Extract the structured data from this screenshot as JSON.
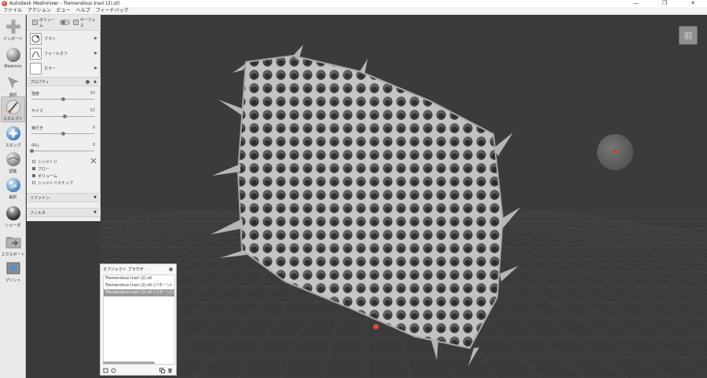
{
  "window": {
    "title": "Autodesk Meshmixer - Tremendous Inari (2).stl",
    "controls": [
      "—",
      "❐",
      "✕"
    ]
  },
  "menu": [
    "ファイル",
    "アクション",
    "ビュー",
    "ヘルプ",
    "フィードバック"
  ],
  "toolbar": [
    {
      "label": "インポート",
      "icon": "plus-icon"
    },
    {
      "label": "Meshmix",
      "icon": "meshmix-ball-icon"
    },
    {
      "label": "選択",
      "icon": "select-arrow-icon"
    },
    {
      "label": "スカルプト",
      "icon": "brush-icon",
      "active": true
    },
    {
      "label": "スタンプ",
      "icon": "stamp-icon"
    },
    {
      "label": "調整",
      "icon": "edit-sphere-icon"
    },
    {
      "label": "解析",
      "icon": "analysis-sphere-icon"
    },
    {
      "label": "シェーダ",
      "icon": "shader-sphere-icon"
    },
    {
      "label": "エクスポート",
      "icon": "export-folder-icon"
    },
    {
      "label": "プリント",
      "icon": "print-icon"
    }
  ],
  "sculpt": {
    "mode_volume": "ボリューム",
    "mode_surface": "サーフェス",
    "brush_label": "ブラシ",
    "falloff_label": "フォールオフ",
    "color_label": "カラー",
    "properties_header": "プロパティ",
    "props": [
      {
        "label": "強度",
        "value": "50",
        "fraction": 0.5
      },
      {
        "label": "サイズ",
        "value": "52",
        "fraction": 0.52
      },
      {
        "label": "奥行き",
        "value": "0",
        "fraction": 0.5
      },
      {
        "label": "中心",
        "value": "0",
        "fraction": 0.0
      }
    ],
    "checks": [
      {
        "label": "シンメトリ",
        "checked": false
      },
      {
        "label": "フロー",
        "checked": true
      },
      {
        "label": "ボリューム",
        "checked": true
      },
      {
        "label": "シンメトリスナップ",
        "checked": false
      }
    ],
    "refine_header": "リファイン",
    "filter_header": "フィルタ"
  },
  "viewcube": {
    "label": "前"
  },
  "object_browser": {
    "title": "オブジェクト ブラウザ",
    "items": [
      {
        "name": "Tremendous Inari (2).stl",
        "selected": false
      },
      {
        "name": "Tremendous Inari (2).stl (パターン)",
        "selected": false
      },
      {
        "name": "Tremendous Inari (2).stl (パターン) (パター",
        "selected": true
      }
    ]
  },
  "colors": {
    "viewport_bg": "#3b3b3b",
    "mesh": "#bdbdbd",
    "accent_red": "#e14a3a"
  }
}
